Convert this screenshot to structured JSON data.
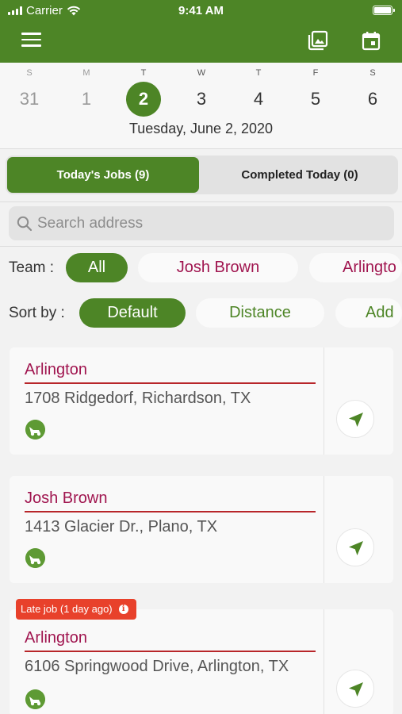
{
  "status_bar": {
    "carrier": "Carrier",
    "time": "9:41 AM"
  },
  "header": {
    "menu_icon": "hamburger-menu-icon",
    "gallery_icon": "photo-gallery-icon",
    "calendar_icon": "calendar-icon",
    "color": "#4d8526"
  },
  "calendar": {
    "days": [
      {
        "name": "S",
        "num": "31"
      },
      {
        "name": "M",
        "num": "1"
      },
      {
        "name": "T",
        "num": "2"
      },
      {
        "name": "W",
        "num": "3"
      },
      {
        "name": "T",
        "num": "4"
      },
      {
        "name": "F",
        "num": "5"
      },
      {
        "name": "S",
        "num": "6"
      }
    ],
    "selected_index": 2,
    "selected_date": "Tuesday, June 2, 2020"
  },
  "tabs": {
    "todays_jobs": "Today's Jobs (9)",
    "completed_today": "Completed Today (0)"
  },
  "search": {
    "placeholder": "Search address",
    "value": ""
  },
  "team_filter": {
    "label": "Team :",
    "options": [
      "All",
      "Josh Brown",
      "Arlingto"
    ],
    "selected": "All"
  },
  "sort_filter": {
    "label": "Sort by :",
    "options": [
      "Default",
      "Distance",
      "Add"
    ],
    "selected": "Default"
  },
  "jobs": [
    {
      "team": "Arlington",
      "address": "1708 Ridgedorf, Richardson, TX",
      "icon": "lawn-mower-icon",
      "nav_icon": "navigation-arrow-icon"
    },
    {
      "team": "Josh Brown",
      "address": "1413 Glacier Dr., Plano, TX",
      "icon": "lawn-mower-icon",
      "nav_icon": "navigation-arrow-icon"
    },
    {
      "team": "Arlington",
      "address": "6106 Springwood Drive, Arlington, TX",
      "icon": "lawn-mower-icon",
      "nav_icon": "navigation-arrow-icon",
      "badge": "Late job (1 day ago)"
    }
  ],
  "colors": {
    "accent": "#4d8526",
    "team_text": "#a0154f",
    "team_underline": "#b8262a",
    "late_badge": "#e8412b"
  }
}
